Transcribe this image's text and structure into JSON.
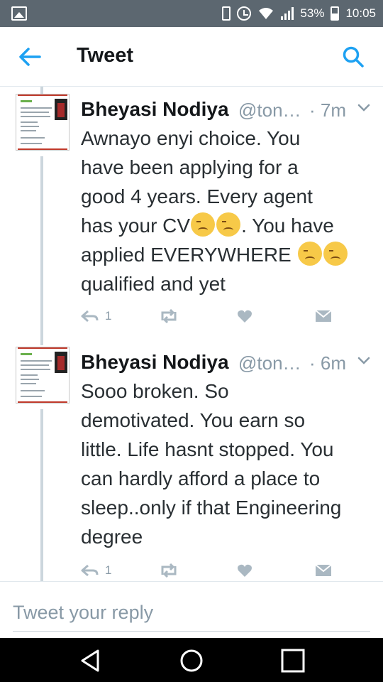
{
  "status_bar": {
    "battery_percent": "53%",
    "time": "10:05"
  },
  "header": {
    "title": "Tweet"
  },
  "tweets": [
    {
      "author": "Bheyasi Nodiya",
      "handle": "@ton…",
      "time": "· 7m",
      "text_lines": [
        "Awnayo enyi choice. You",
        "have been applying for a",
        "good 4 years. Every agent",
        "has your CV",
        ". You have",
        "applied EVERYWHERE",
        "qualified and yet"
      ],
      "reply_count": "1"
    },
    {
      "author": "Bheyasi Nodiya",
      "handle": "@ton…",
      "time": "· 6m",
      "text_lines": [
        "Sooo broken. So",
        "demotivated. You earn so",
        "little. Life hasnt stopped. You",
        "can hardly afford a place to",
        "sleep..only if that Engineering",
        "degree"
      ],
      "reply_count": "1"
    }
  ],
  "reply": {
    "placeholder": "Tweet your reply"
  },
  "colors": {
    "accent": "#1da1f2",
    "status_bar": "#5c6770",
    "muted": "#8899a6"
  }
}
